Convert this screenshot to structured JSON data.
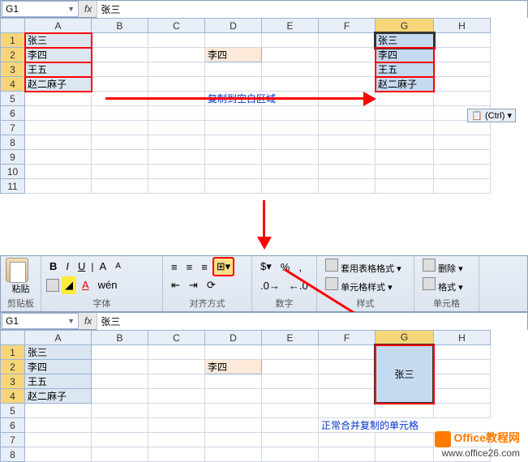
{
  "top": {
    "name_box": "G1",
    "formula_value": "张三",
    "columns": [
      "A",
      "B",
      "C",
      "D",
      "E",
      "F",
      "G",
      "H"
    ],
    "rows": [
      1,
      2,
      3,
      4,
      5,
      6,
      7,
      8,
      9,
      10,
      11
    ],
    "colA": [
      "张三",
      "李四",
      "王五",
      "赵二麻子"
    ],
    "d2": "李四",
    "colG": [
      "张三",
      "李四",
      "王五",
      "赵二麻子"
    ],
    "anno": "复制到空白区域",
    "ctrl_label": "(Ctrl) ▾"
  },
  "ribbon": {
    "paste": "粘贴",
    "clipboard": "剪贴板",
    "bold": "B",
    "italic": "I",
    "underline": "U",
    "font_group": "字体",
    "align_group": "对齐方式",
    "number_group": "数字",
    "percent": "%",
    "comma": ",",
    "style_opt1": "套用表格格式 ▾",
    "style_opt2": "单元格样式 ▾",
    "style_group": "样式",
    "del_btn": "删除 ▾",
    "fmt_btn": "格式 ▾",
    "cell_group": "单元格"
  },
  "bottom": {
    "name_box": "G1",
    "formula_value": "张三",
    "columns": [
      "A",
      "B",
      "C",
      "D",
      "E",
      "F",
      "G",
      "H"
    ],
    "rows": [
      1,
      2,
      3,
      4,
      5,
      6,
      7,
      8
    ],
    "colA": [
      "张三",
      "李四",
      "王五",
      "赵二麻子"
    ],
    "d2": "李四",
    "merged": "张三",
    "anno": "正常合并复制的单元格"
  },
  "watermark": {
    "brand": "Office教程网",
    "url": "www.office26.com"
  }
}
